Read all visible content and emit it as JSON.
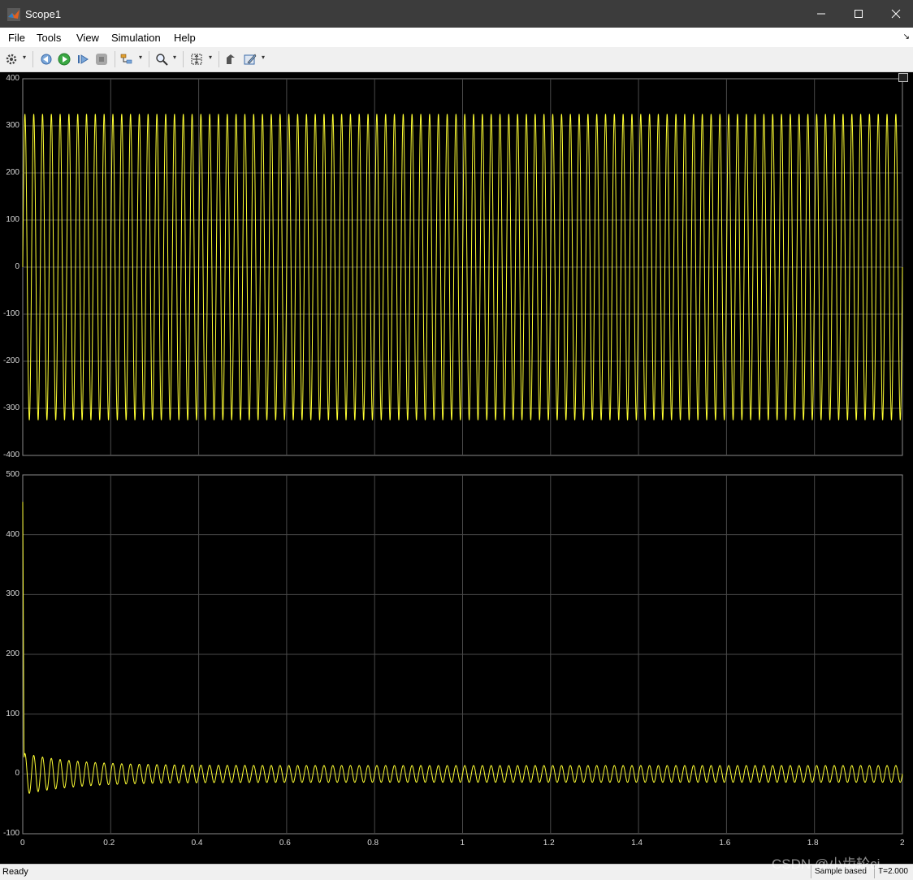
{
  "window": {
    "title": "Scope1"
  },
  "menu": {
    "items": [
      "File",
      "Tools",
      "View",
      "Simulation",
      "Help"
    ]
  },
  "toolbar": {
    "icons": [
      "gear-icon",
      "step-back-icon",
      "run-icon",
      "step-forward-icon",
      "stop-icon",
      "signal-selector-icon",
      "zoom-icon",
      "fit-to-view-icon",
      "highlight-block-icon",
      "edit-icon"
    ]
  },
  "colors": {
    "signal": "#ffff33",
    "plot_bg": "#000000",
    "grid": "#4a4a4a",
    "tick": "#d8d8d8"
  },
  "chart_data": [
    {
      "type": "line",
      "xlim": [
        0,
        2
      ],
      "ylim": [
        -400,
        400
      ],
      "yticks": [
        "400",
        "300",
        "200",
        "100",
        "0",
        "-100",
        "-200",
        "-300",
        "-400"
      ],
      "grid": true,
      "series": [
        {
          "frequency_hz": 50,
          "amplitude": 325,
          "offset": 0
        }
      ]
    },
    {
      "type": "line",
      "xlim": [
        0,
        2
      ],
      "ylim": [
        -100,
        500
      ],
      "yticks": [
        "500",
        "400",
        "300",
        "200",
        "100",
        "0",
        "-100"
      ],
      "xticks": [
        "0",
        "0.2",
        "0.4",
        "0.6",
        "0.8",
        "1",
        "1.2",
        "1.4",
        "1.6",
        "1.8",
        "2"
      ],
      "grid": true,
      "series": [
        {
          "frequency_hz": 50,
          "initial_spike": 455,
          "initial_amplitude": 35,
          "steady_amplitude": 14,
          "settle_time": 0.35
        }
      ]
    }
  ],
  "status": {
    "state": "Ready",
    "mode": "Sample based",
    "time": "T=2.000"
  },
  "watermark": "CSDN @小齿轮ci"
}
